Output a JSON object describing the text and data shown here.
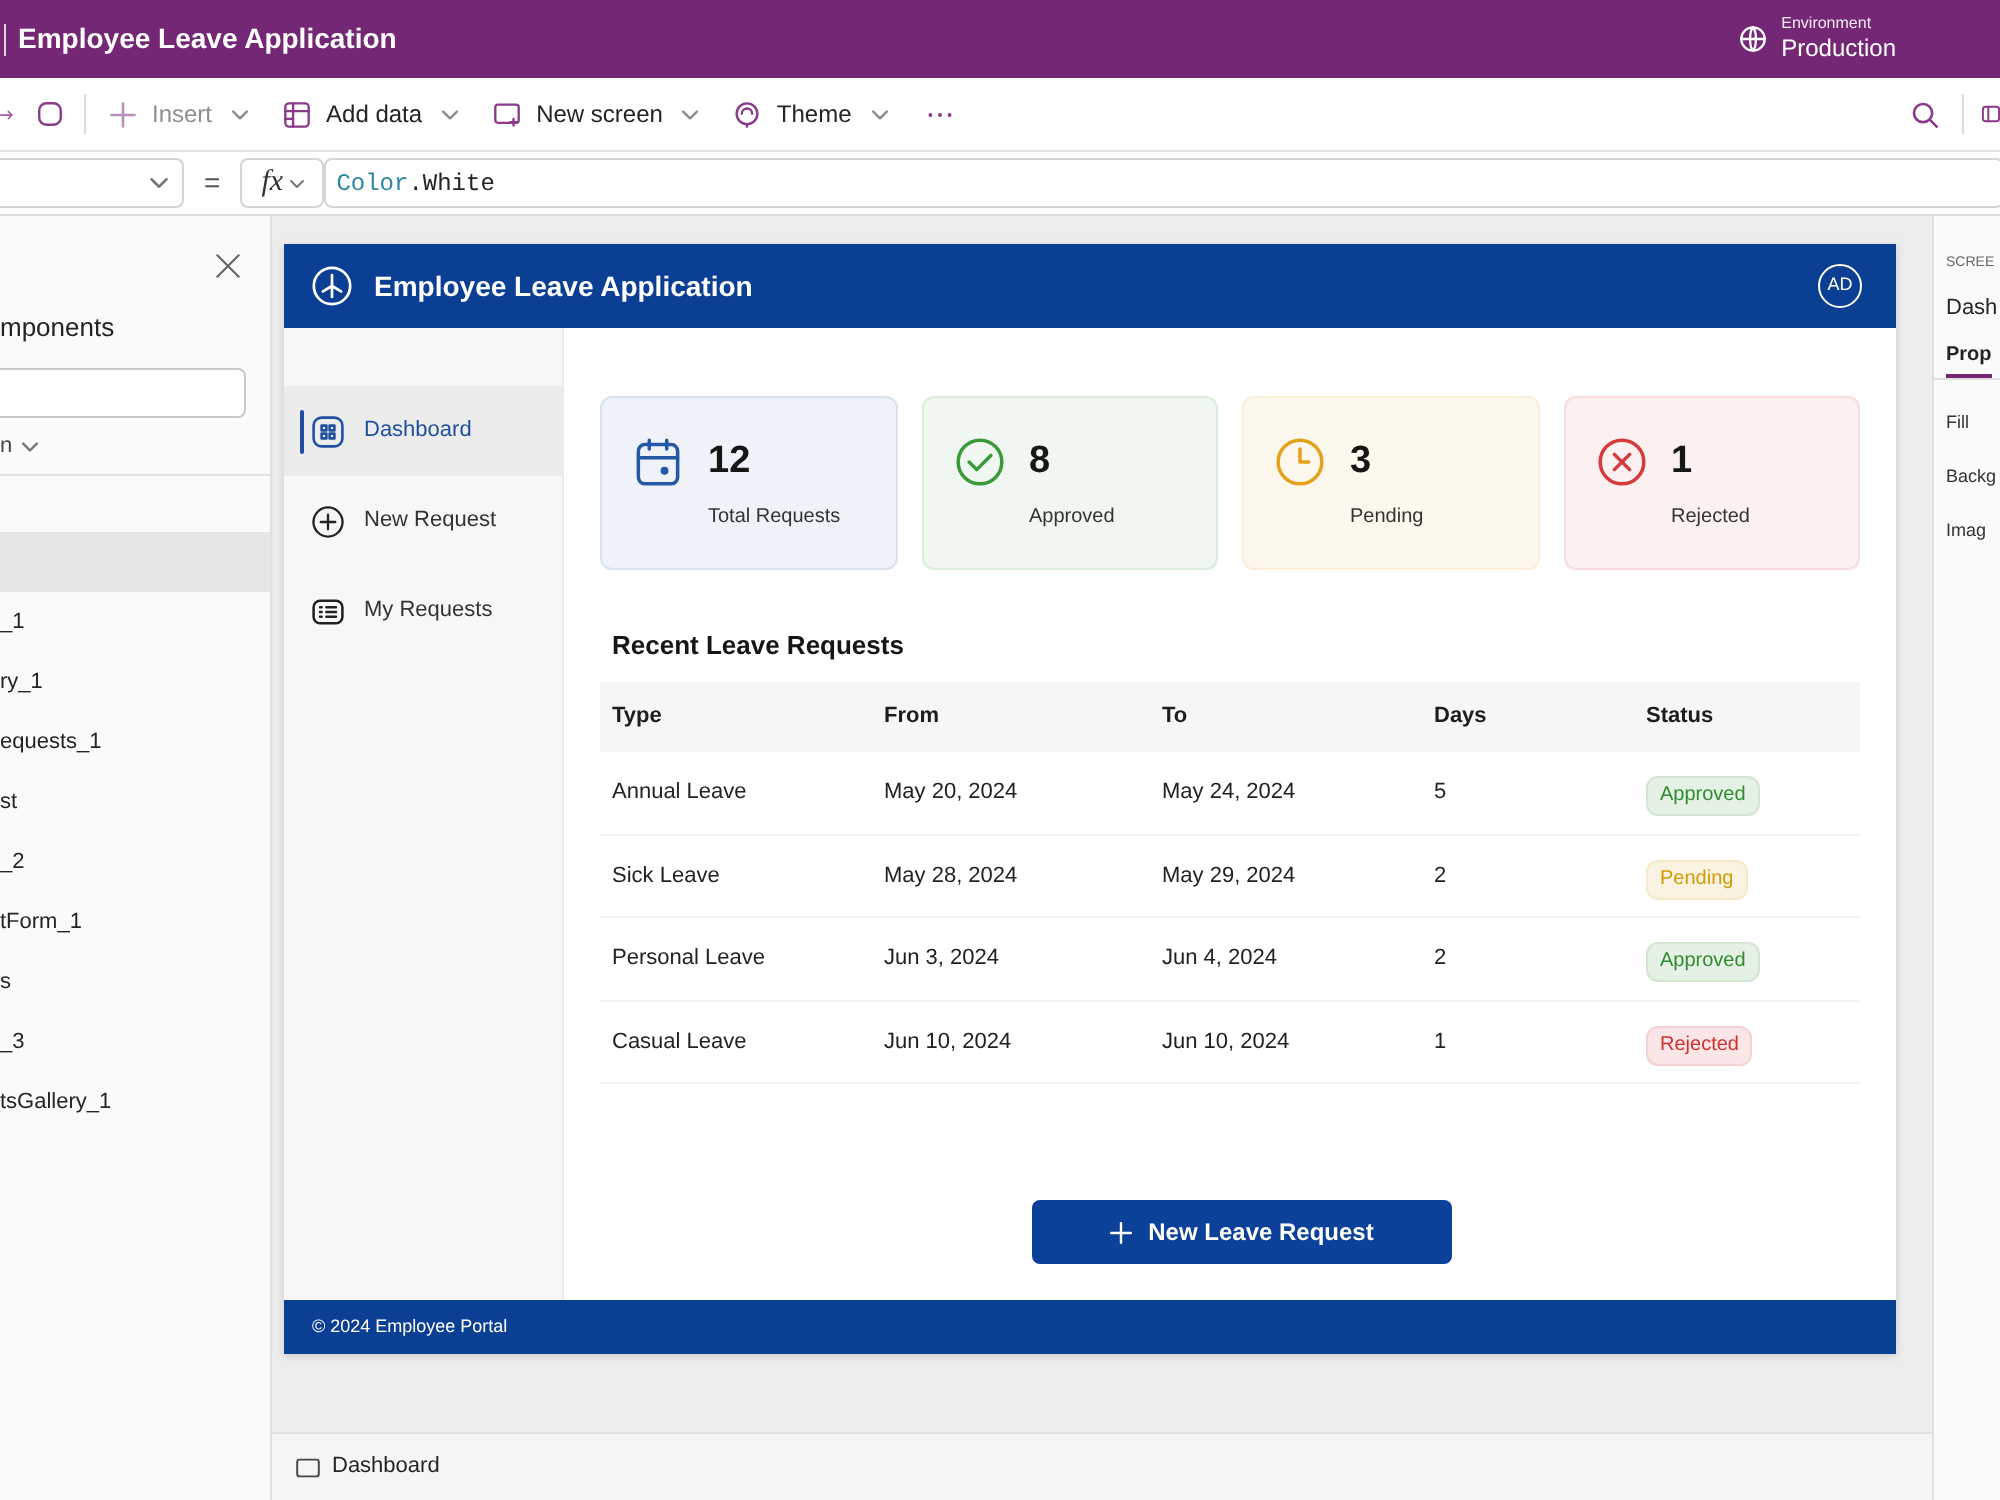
{
  "title_bar": {
    "title": "Employee Leave Application",
    "environment_label": "Environment",
    "environment": "Production"
  },
  "toolbar": {
    "items": [
      {
        "label": "Insert",
        "kind": "insert",
        "disabled": true
      },
      {
        "label": "Add data",
        "kind": "data",
        "disabled": false
      },
      {
        "label": "New screen",
        "kind": "screen",
        "disabled": false
      },
      {
        "label": "Theme",
        "kind": "theme",
        "disabled": false
      }
    ]
  },
  "formula_bar": {
    "operator": "=",
    "function_label": "fx",
    "tokens": [
      {
        "text": "Color",
        "kind": "enum"
      },
      {
        "text": ".White",
        "kind": "plain"
      }
    ]
  },
  "tree_panel": {
    "title": "mponents",
    "filter": "n",
    "items": [
      {
        "selected": true
      },
      {
        "label": "_1",
        "selected": false
      },
      {
        "label": "ry_1",
        "selected": false
      },
      {
        "label": "equests_1",
        "selected": false
      },
      {
        "label": "st",
        "selected": false
      },
      {
        "label": "_2",
        "selected": false
      },
      {
        "label": "tForm_1",
        "selected": false
      },
      {
        "label": "s",
        "selected": false
      },
      {
        "label": "_3",
        "selected": false
      },
      {
        "label": "tsGallery_1",
        "selected": false
      }
    ]
  },
  "app": {
    "header": {
      "title": "Employee Leave Application",
      "avatar": "AD"
    },
    "nav": [
      {
        "label": "Dashboard",
        "kind": "dashboard",
        "selected": true
      },
      {
        "label": "New Request",
        "kind": "new",
        "selected": false
      },
      {
        "label": "My Requests",
        "kind": "list",
        "selected": false
      }
    ],
    "stats": [
      {
        "value": "12",
        "label": "Total Requests",
        "kind": "total",
        "color": "#2457a6"
      },
      {
        "value": "8",
        "label": "Approved",
        "kind": "approved",
        "color": "#3a9a3a"
      },
      {
        "value": "3",
        "label": "Pending",
        "kind": "pending",
        "color": "#e3a21a"
      },
      {
        "value": "1",
        "label": "Rejected",
        "kind": "rejected",
        "color": "#d8393b"
      }
    ],
    "recent_requests": {
      "title": "Recent Leave Requests",
      "columns": [
        "Type",
        "From",
        "To",
        "Days",
        "Status"
      ],
      "rows": [
        {
          "cells": [
            "Annual Leave",
            "May 20, 2024",
            "May 24, 2024",
            "5"
          ],
          "status": {
            "label": "Approved",
            "color": "#2e8b2e"
          }
        },
        {
          "cells": [
            "Sick Leave",
            "May 28, 2024",
            "May 29, 2024",
            "2"
          ],
          "status": {
            "label": "Pending",
            "color": "#d49a06"
          }
        },
        {
          "cells": [
            "Personal Leave",
            "Jun 3, 2024",
            "Jun 4, 2024",
            "2"
          ],
          "status": {
            "label": "Approved",
            "color": "#2e8b2e"
          }
        },
        {
          "cells": [
            "Casual Leave",
            "Jun 10, 2024",
            "Jun 10, 2024",
            "1"
          ],
          "status": {
            "label": "Rejected",
            "color": "#d32f2f"
          }
        }
      ]
    },
    "primary_button": {
      "label": "New Leave Request"
    },
    "footer": "© 2024 Employee Portal"
  },
  "screen_bar": {
    "screen": "Dashboard"
  },
  "properties_panel": {
    "section": "SCREE",
    "name": "Dash",
    "tabs": [
      {
        "label": "Prop",
        "selected": true
      }
    ],
    "properties": [
      "Fill",
      "Backg",
      "Imag"
    ]
  }
}
